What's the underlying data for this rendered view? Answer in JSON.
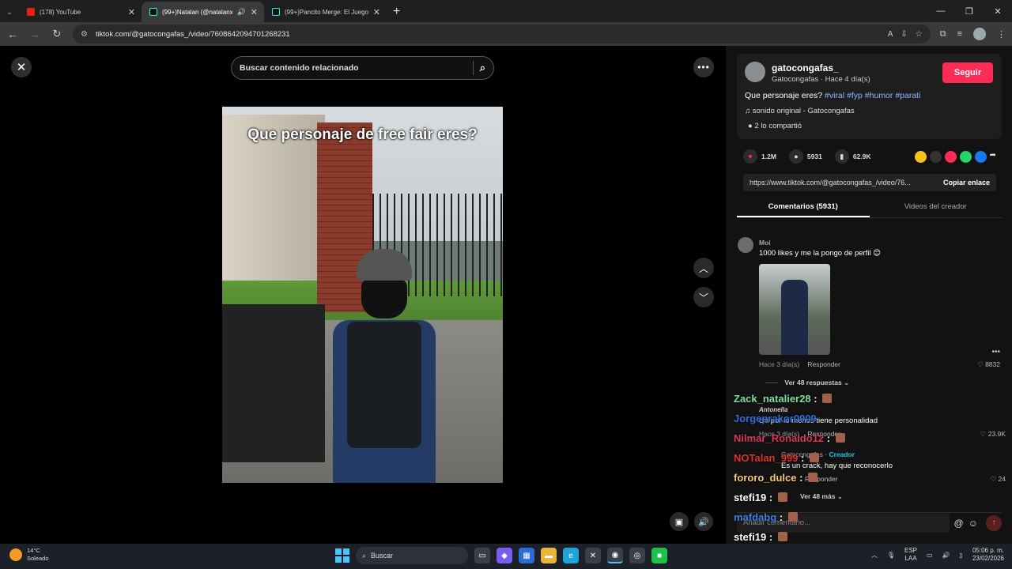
{
  "browser": {
    "tabs": [
      {
        "title": "(178) YouTube",
        "active": false
      },
      {
        "title": "(99+)Natalan (@natalanx) |",
        "active": true
      },
      {
        "title": "(99+)Pancito Merge: El Juego I",
        "active": false
      }
    ],
    "url": "tiktok.com/@gatocongafas_/video/7608642094701268231"
  },
  "video": {
    "search_placeholder": "Buscar contenido relacionado",
    "caption": "Que personaje de free fair eres?"
  },
  "post": {
    "username": "gatocongafas_",
    "meta": "Gatocongafas · Hace 4 día(s)",
    "follow_label": "Seguir",
    "description": "Que personaje eres?",
    "hashtags": [
      "#viral",
      "#fyp",
      "#humor",
      "#parati"
    ],
    "sound": "sonido original - Gatocongafas",
    "shared": "2 lo compartió",
    "likes": "1.2M",
    "comments": "5931",
    "saves": "62.9K",
    "link": "https://www.tiktok.com/@gatocongafas_/video/76...",
    "copy_label": "Copiar enlace",
    "tab_comments": "Comentarios (5931)",
    "tab_videos": "Videos del creador"
  },
  "comments": [
    {
      "user": "Moi",
      "text": "1000 likes y me la pongo de perfil 😊",
      "time": "Hace 3 día(s)",
      "reply_label": "Responder",
      "likes": "8832",
      "view_replies": "Ver 48 respuestas"
    },
    {
      "user": "Antonella",
      "text": "chi por lo menos tiene personalidad",
      "time": "Hace 3 día(s)",
      "reply_label": "Responder",
      "likes": "23.9K"
    },
    {
      "user": "Gatocongafas",
      "creator_badge": "Creador",
      "text": "Es un crack, hay que reconocerlo",
      "reply_label": "Responder",
      "likes": "24",
      "see_more": "Ver 48 más"
    }
  ],
  "composer": {
    "placeholder": "Añadir comentario..."
  },
  "live_chat": [
    {
      "user": "Zack_natalier28",
      "color": "#7ee0a0"
    },
    {
      "user": "Jorgeprakor0909",
      "color": "#2f6fe0"
    },
    {
      "user": "Nilmar_Ronaldo12",
      "color": "#d8385a"
    },
    {
      "user": "NOTalan_999",
      "color": "#e0322a"
    },
    {
      "user": "fororo_dulce",
      "color": "#f4c77a"
    },
    {
      "user": "stefi19",
      "color": "#ffffff"
    },
    {
      "user": "mafdabg",
      "color": "#3e7fe0"
    },
    {
      "user": "stefi19",
      "color": "#ffffff"
    }
  ],
  "taskbar": {
    "weather_temp": "14°C",
    "weather_desc": "Soleado",
    "search_label": "Buscar",
    "lang_1": "ESP",
    "lang_2": "LAA",
    "time": "05:06 p. m.",
    "date": "23/02/2026"
  }
}
